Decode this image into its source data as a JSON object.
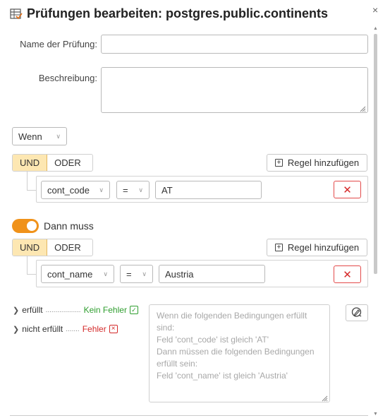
{
  "header": {
    "title": "Prüfungen bearbeiten: postgres.public.continents",
    "close_glyph": "×"
  },
  "form": {
    "name_label": "Name der Prüfung:",
    "name_value": "",
    "description_label": "Beschreibung:",
    "description_value": ""
  },
  "condition": {
    "wenn_label": "Wenn",
    "und_label": "UND",
    "oder_label": "ODER",
    "active_operator": "UND",
    "add_rule_label": "Regel hinzufügen",
    "rule": {
      "field": "cont_code",
      "operator": "=",
      "value": "AT"
    }
  },
  "consequence": {
    "toggle_on": true,
    "dann_label": "Dann muss",
    "und_label": "UND",
    "oder_label": "ODER",
    "active_operator": "UND",
    "add_rule_label": "Regel hinzufügen",
    "rule": {
      "field": "cont_name",
      "operator": "=",
      "value": "Austria"
    }
  },
  "results": {
    "fulfilled_label": "erfüllt",
    "fulfilled_status": "Kein Fehler",
    "not_fulfilled_label": "nicht erfüllt",
    "not_fulfilled_status": "Fehler",
    "summary": "Wenn die folgenden Bedingungen erfüllt sind:\nFeld 'cont_code' ist gleich 'AT'\nDann müssen die folgenden Bedingungen erfüllt sein:\nFeld 'cont_name' ist gleich 'Austria'"
  },
  "colors": {
    "accent": "#f0921a",
    "active_segment": "#fde7b2",
    "success": "#2f9e2f",
    "error": "#d42a2a"
  }
}
